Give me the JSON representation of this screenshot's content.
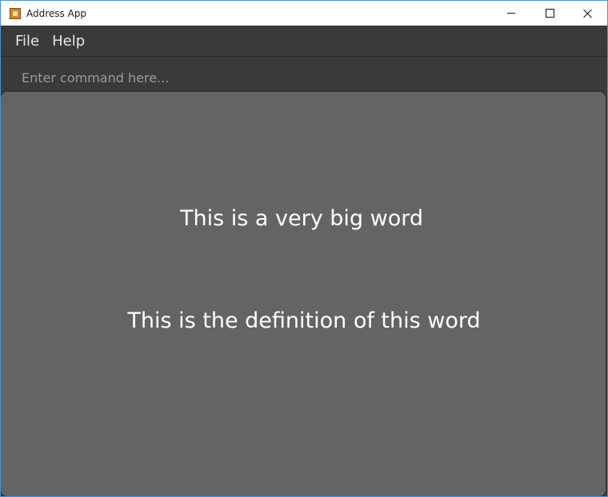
{
  "window": {
    "title": "Address App",
    "icon": "address-book-icon",
    "controls": {
      "minimize": "minimize-icon",
      "maximize": "maximize-icon",
      "close": "close-icon"
    }
  },
  "menubar": {
    "items": [
      {
        "label": "File"
      },
      {
        "label": "Help"
      }
    ]
  },
  "command": {
    "value": "",
    "placeholder": "Enter command here..."
  },
  "flashcard": {
    "word": "This is a very big word",
    "definition": "This is the definition of this word"
  },
  "colors": {
    "background": "#3a3a3a",
    "panel": "#646464",
    "text": "#ffffff",
    "window_border": "#4a90d9"
  }
}
